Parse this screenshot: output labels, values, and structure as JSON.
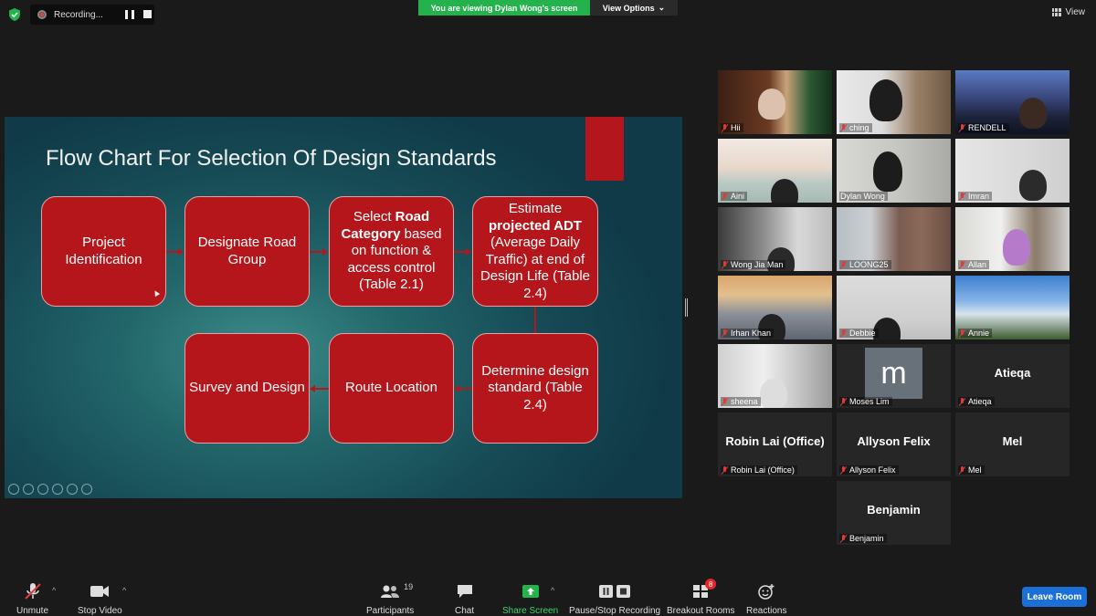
{
  "top": {
    "recording_label": "Recording...",
    "viewing_banner": "You are viewing Dylan Wong's screen",
    "view_options": "View Options",
    "view_label": "View"
  },
  "slide": {
    "title": "Flow Chart For Selection Of Design Standards",
    "boxes": {
      "b1": "Project Identification",
      "b2": "Designate Road Group",
      "b3_pre": "Select ",
      "b3_bold": "Road Category",
      "b3_post": " based on function & access control (Table 2.1)",
      "b4_pre": "Estimate ",
      "b4_bold": "projected ADT",
      "b4_post": " (Average Daily Traffic) at end of Design Life (Table 2.4)",
      "b5": "Determine design standard (Table 2.4)",
      "b6": "Route Location",
      "b7": "Survey and Design"
    }
  },
  "participants": [
    {
      "name": "Hii"
    },
    {
      "name": "ching"
    },
    {
      "name": "RENDELL"
    },
    {
      "name": "Aini"
    },
    {
      "name": "Dylan Wong"
    },
    {
      "name": "Imran"
    },
    {
      "name": "Wong Jia Man"
    },
    {
      "name": "LOONG25"
    },
    {
      "name": "Allan"
    },
    {
      "name": "Irhan Khan"
    },
    {
      "name": "Debbie"
    },
    {
      "name": "Annie"
    },
    {
      "name": "sheena"
    },
    {
      "name": "Moses Lim",
      "avatar": "m"
    },
    {
      "name": "Atieqa",
      "big": "Atieqa"
    },
    {
      "name": "Robin Lai (Office)",
      "big": "Robin Lai (Office)"
    },
    {
      "name": "Allyson Felix",
      "big": "Allyson Felix"
    },
    {
      "name": "Mel",
      "big": "Mel"
    },
    {
      "name": "Benjamin",
      "big": "Benjamin"
    }
  ],
  "toolbar": {
    "unmute": "Unmute",
    "stop_video": "Stop Video",
    "participants": "Participants",
    "participant_count": "19",
    "chat": "Chat",
    "share_screen": "Share Screen",
    "pause_stop_recording": "Pause/Stop Recording",
    "breakout_rooms": "Breakout Rooms",
    "breakout_badge": "8",
    "reactions": "Reactions",
    "leave_room": "Leave Room"
  },
  "colors": {
    "share_green": "#23b24b",
    "leave_blue": "#1d6fd8",
    "slide_red": "#b5161b",
    "active_speaker": "#c6e86a",
    "muted_red": "#e03a3a"
  }
}
